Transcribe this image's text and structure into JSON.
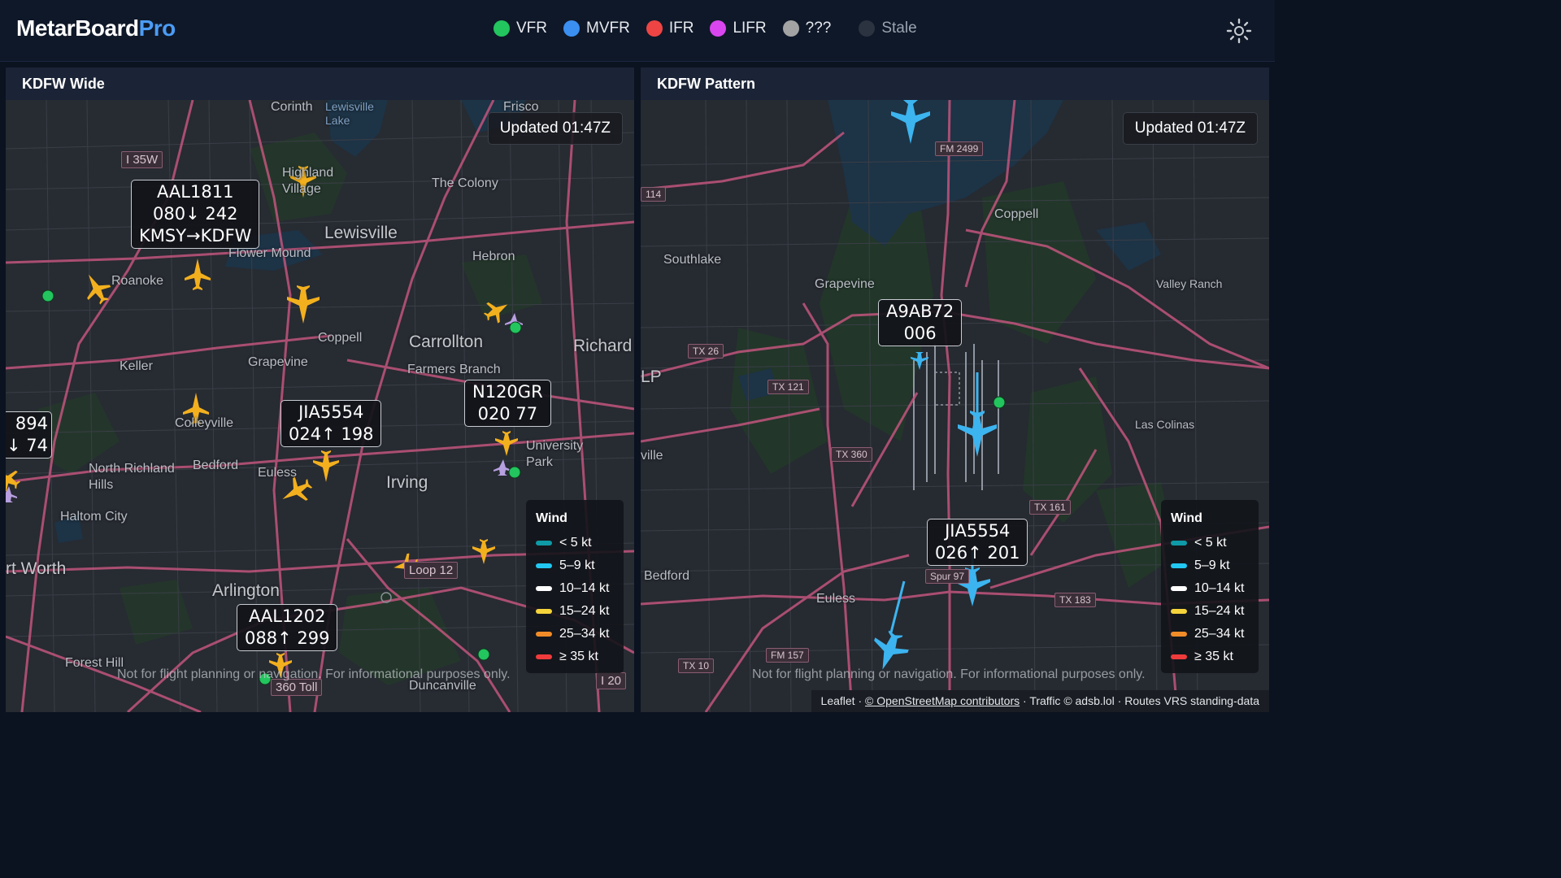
{
  "app": {
    "brand_part1": "MetarBoard",
    "brand_part2": "Pro"
  },
  "flight_categories": [
    {
      "label": "VFR",
      "color": "#22c55e"
    },
    {
      "label": "MVFR",
      "color": "#3b8ff0"
    },
    {
      "label": "IFR",
      "color": "#ef4444"
    },
    {
      "label": "LIFR",
      "color": "#d946ef"
    },
    {
      "label": "???",
      "color": "#a3a3a3"
    },
    {
      "label": "Stale",
      "color": "#2b3340"
    }
  ],
  "settings_icon": "gear-icon",
  "wind_legend": {
    "title": "Wind",
    "items": [
      {
        "label": "< 5 kt",
        "color": "#0e9aa7"
      },
      {
        "label": "5–9 kt",
        "color": "#22c7f2"
      },
      {
        "label": "10–14 kt",
        "color": "#ffffff"
      },
      {
        "label": "15–24 kt",
        "color": "#f5d33b"
      },
      {
        "label": "25–34 kt",
        "color": "#f28c28"
      },
      {
        "label": "≥ 35 kt",
        "color": "#ef3b3b"
      }
    ]
  },
  "disclaimer": "Not for flight planning or navigation. For informational purposes only.",
  "panels": {
    "wide": {
      "title": "KDFW Wide",
      "updated": "Updated 01:47Z",
      "labels": [
        {
          "lines": [
            "AAL1811",
            "080↓ 242",
            "KMSY→KDFW"
          ]
        },
        {
          "lines": [
            "JIA5554",
            "024↑ 198"
          ]
        },
        {
          "lines": [
            "N120GR",
            "020 77"
          ]
        },
        {
          "lines": [
            "AAL1202",
            "088↑ 299"
          ]
        }
      ],
      "partial_label": [
        "894",
        "↓ 74"
      ],
      "places": [
        "Corinth",
        "Lewisville Lake",
        "Highland Village",
        "The Colony",
        "Lewisville",
        "Flower Mound",
        "Roanoke",
        "Hebron",
        "Coppell",
        "Carrollton",
        "Richard",
        "Keller",
        "Grapevine",
        "Farmers Branch",
        "Colleyville",
        "University Park",
        "North Richland Hills",
        "Bedford",
        "Euless",
        "Irving",
        "Haltom City",
        "rt Worth",
        "Arlington",
        "Forest Hill",
        "Duncanville",
        "Frisco"
      ],
      "shields": [
        "I 35W",
        "Loop 12",
        "360 Toll",
        "I 20"
      ]
    },
    "pattern": {
      "title": "KDFW Pattern",
      "updated": "Updated 01:47Z",
      "labels": [
        {
          "lines": [
            "A9AB72",
            "006"
          ]
        },
        {
          "lines": [
            "JIA5554",
            "026↑ 201"
          ]
        }
      ],
      "places": [
        "Coppell",
        "Southlake",
        "Grapevine",
        "Valley Ranch",
        "Las Colinas",
        "Bedford",
        "Euless",
        "LP",
        "ville"
      ],
      "shields": [
        "FM 2499",
        "114",
        "TX 26",
        "TX 121",
        "TX 360",
        "TX 161",
        "Spur 97",
        "TX 183",
        "FM 157",
        "TX 10"
      ],
      "attribution": {
        "leaflet": "Leaflet",
        "osm": "© OpenStreetMap contributors",
        "traffic": "Traffic © adsb.lol",
        "routes": "Routes VRS standing-data"
      }
    }
  }
}
